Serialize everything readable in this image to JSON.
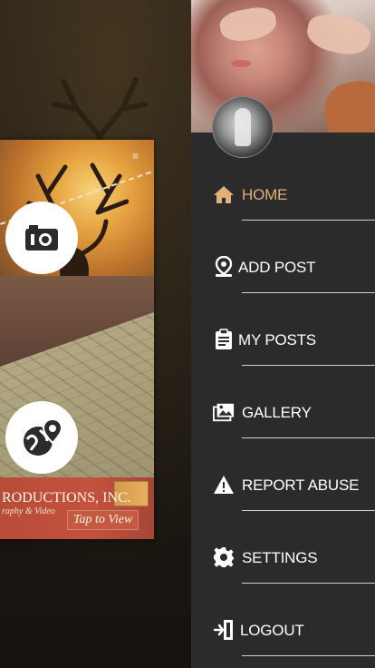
{
  "preview_card": {
    "banner_title": "RODUCTIONS, INC.",
    "banner_sub": "raphy & Video",
    "tap_button": "Tap to View"
  },
  "drawer": {
    "menu_items": [
      {
        "label": "HOME",
        "icon": "home-icon",
        "active": true
      },
      {
        "label": "ADD POST",
        "icon": "location-pin-icon"
      },
      {
        "label": "MY POSTS",
        "icon": "clipboard-icon"
      },
      {
        "label": "GALLERY",
        "icon": "gallery-icon"
      },
      {
        "label": "REPORT ABUSE",
        "icon": "warning-icon"
      },
      {
        "label": "SETTINGS",
        "icon": "gear-icon"
      },
      {
        "label": "LOGOUT",
        "icon": "logout-icon"
      }
    ]
  },
  "colors": {
    "drawer_bg": "#2b2b2b",
    "active_text": "#e0b07a",
    "text": "#ffffff",
    "divider": "#d0d0d0"
  }
}
